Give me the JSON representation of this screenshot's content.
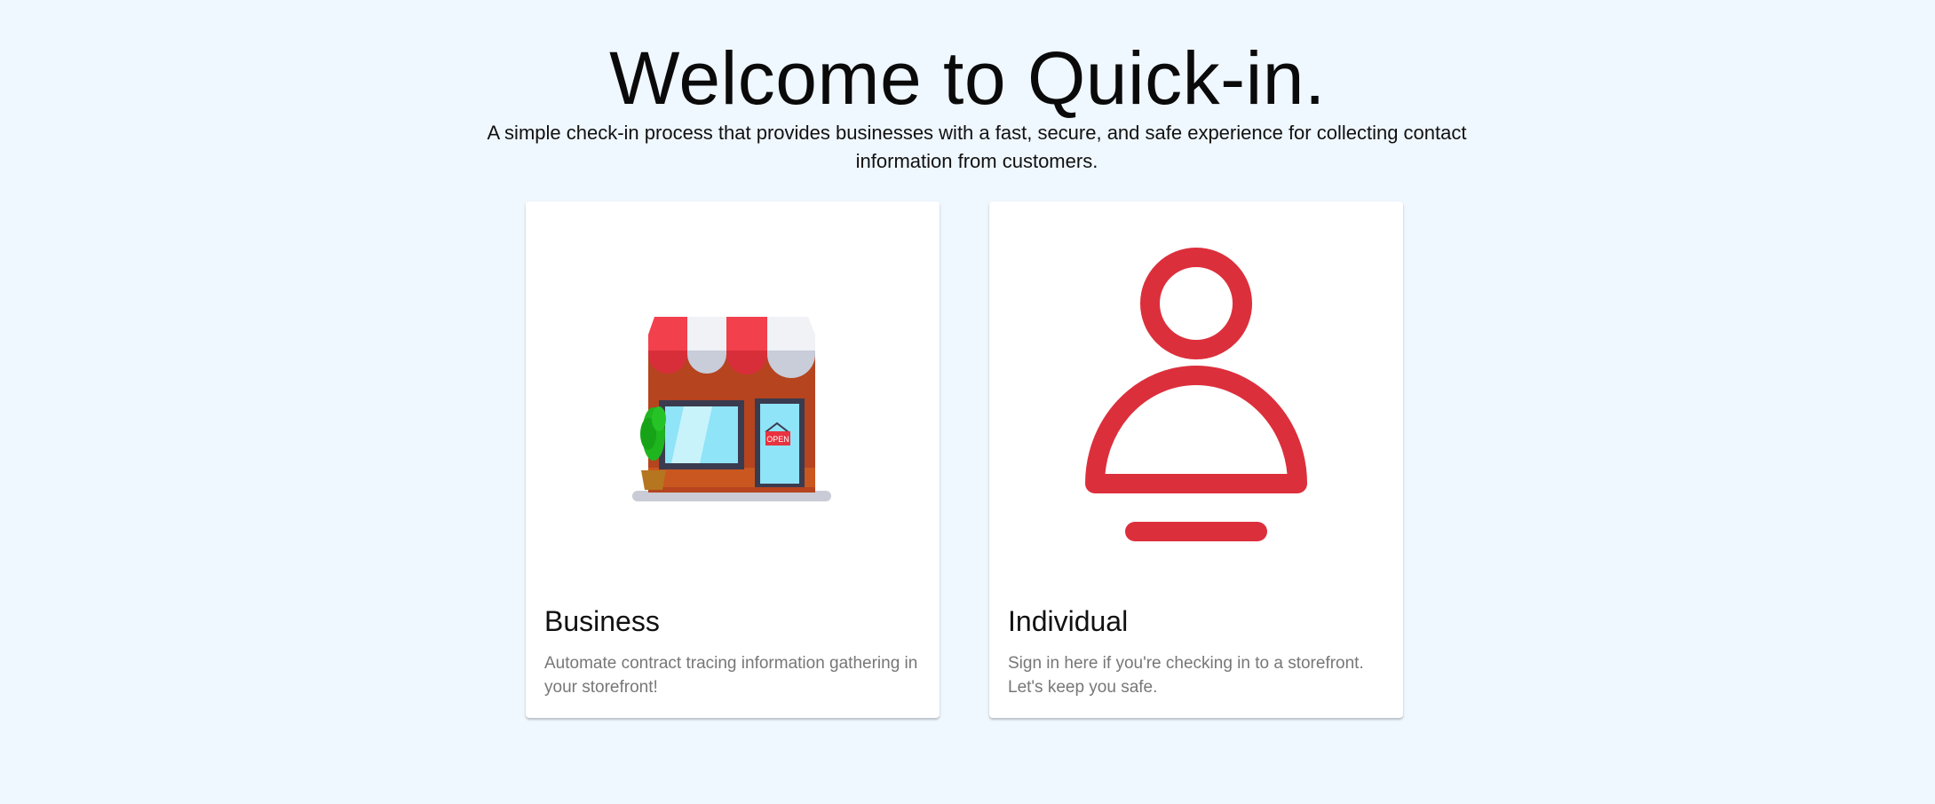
{
  "hero": {
    "title": "Welcome to Quick-in.",
    "subtitle": "A simple check-in process that provides businesses with a fast, secure, and safe experience for collecting contact information from customers."
  },
  "cards": [
    {
      "id": "business",
      "title": "Business",
      "description": "Automate contract tracing information gathering in your storefront!",
      "icon": "storefront-icon",
      "sign_text": "OPEN"
    },
    {
      "id": "individual",
      "title": "Individual",
      "description": "Sign in here if you're checking in to a storefront. Let's keep you safe.",
      "icon": "person-icon"
    }
  ],
  "colors": {
    "background": "#eff7ff",
    "accent_red": "#dc2f3c",
    "card": "#ffffff"
  }
}
